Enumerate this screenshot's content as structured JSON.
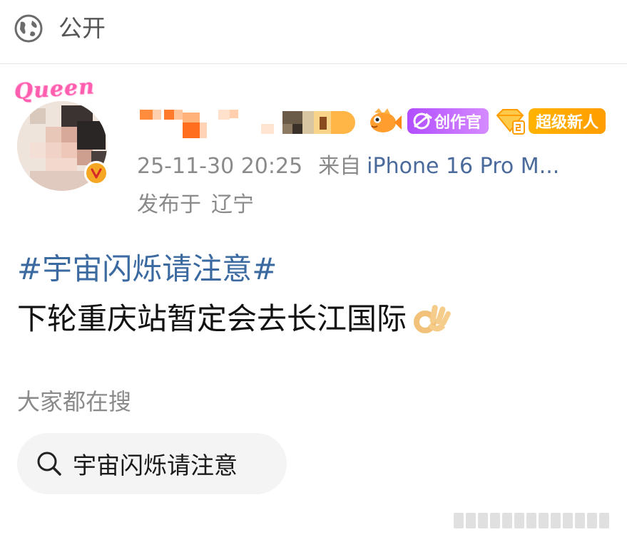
{
  "header": {
    "visibility_icon": "globe-icon",
    "visibility_label": "公开"
  },
  "author": {
    "avatar_frame_text": "Queen",
    "verified_icon": "verified-v-icon",
    "badges": {
      "fish_icon": "fish-icon",
      "creator_label": "创作官",
      "creator_icon": "creator-icon",
      "diamond_icon": "diamond-level-icon",
      "newbie_label": "超级新人"
    }
  },
  "meta": {
    "timestamp": "25-11-30 20:25",
    "from_label": "来自",
    "device": "iPhone 16 Pro M...",
    "location_prefix": "发布于",
    "location": "辽宁"
  },
  "post": {
    "topic": "#宇宙闪烁请注意#",
    "text": "下轮重庆站暂定会去长江国际",
    "emoji": "ok-hand-icon"
  },
  "search_section": {
    "heading": "大家都在搜",
    "chip_icon": "search-icon",
    "chip_label": "宇宙闪烁请注意"
  },
  "colors": {
    "link_blue": "#3b6aa0",
    "muted_gray": "#8a8a8a",
    "creator_purple": "#b14dff",
    "newbie_orange": "#ffa800"
  }
}
